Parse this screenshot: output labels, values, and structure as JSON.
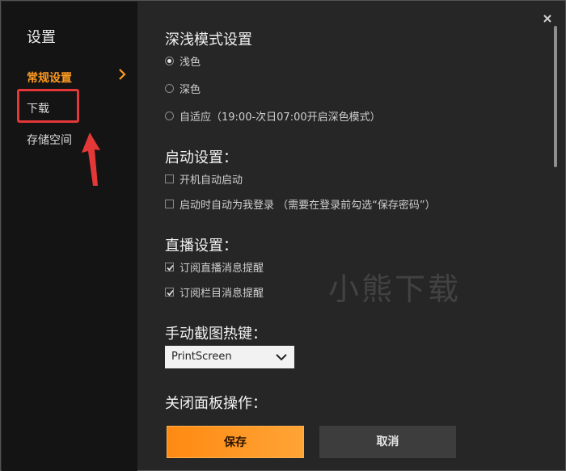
{
  "sidebar": {
    "title": "设置",
    "items": [
      {
        "label": "常规设置",
        "active": true
      },
      {
        "label": "下载",
        "active": false
      },
      {
        "label": "存储空间",
        "active": false
      }
    ]
  },
  "sections": {
    "theme": {
      "heading": "深浅模式设置",
      "options": [
        "浅色",
        "深色",
        "自适应（19:00-次日07:00开启深色模式）"
      ],
      "selected": "浅色"
    },
    "startup": {
      "heading": "启动设置：",
      "options": [
        {
          "label": "开机自动启动",
          "checked": false
        },
        {
          "label": "启动时自动为我登录 （需要在登录前勾选“保存密码”）",
          "checked": false
        }
      ]
    },
    "live": {
      "heading": "直播设置：",
      "options": [
        {
          "label": "订阅直播消息提醒",
          "checked": true
        },
        {
          "label": "订阅栏目消息提醒",
          "checked": true
        }
      ]
    },
    "hotkey": {
      "heading": "手动截图热键：",
      "value": "PrintScreen"
    },
    "close_panel": {
      "heading": "关闭面板操作："
    }
  },
  "buttons": {
    "save": "保存",
    "cancel": "取消"
  },
  "watermark": "小熊下载",
  "colors": {
    "accent": "#ff9a1f",
    "annotation": "#e43737"
  }
}
